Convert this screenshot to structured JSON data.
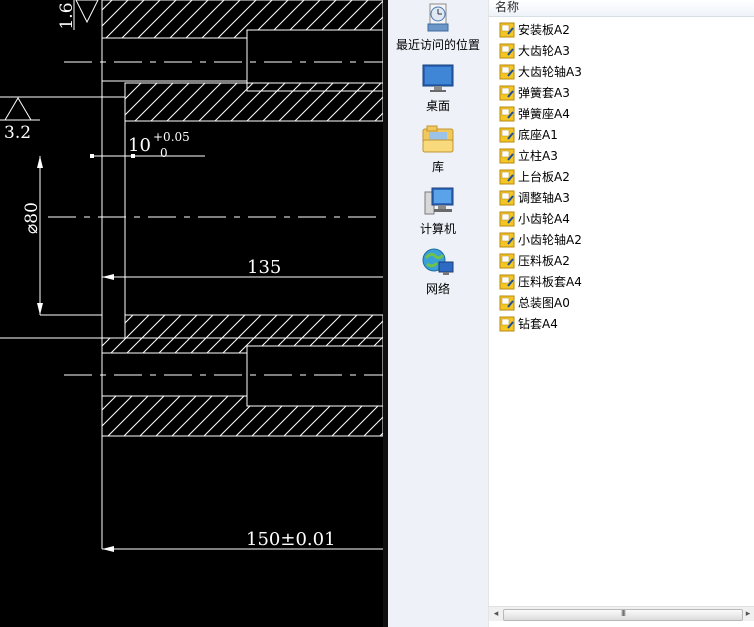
{
  "cad": {
    "dimensions": {
      "roughness_top": "1.6",
      "roughness_left": "3.2",
      "tolerance_base": "10",
      "tolerance_upper": "+0.05",
      "tolerance_lower": "0",
      "diameter": "⌀80",
      "length_inner": "135",
      "length_outer": "150±0.01"
    }
  },
  "places": [
    {
      "label": "最近访问的位置",
      "icon": "recent-places-icon"
    },
    {
      "label": "桌面",
      "icon": "desktop-icon"
    },
    {
      "label": "库",
      "icon": "libraries-icon"
    },
    {
      "label": "计算机",
      "icon": "computer-icon"
    },
    {
      "label": "网络",
      "icon": "network-icon"
    }
  ],
  "file_list": {
    "column_name": "名称",
    "items": [
      "安装板A2",
      "大齿轮A3",
      "大齿轮轴A3",
      "弹簧套A3",
      "弹簧座A4",
      "底座A1",
      "立柱A3",
      "上台板A2",
      "调整轴A3",
      "小齿轮A4",
      "小齿轮轴A2",
      "压料板A2",
      "压料板套A4",
      "总装图A0",
      "钻套A4"
    ],
    "scrollbar_grip": "III"
  },
  "colors": {
    "cad_background": "#000000",
    "cad_lines": "#ffffff",
    "places_background": "#eef2f8",
    "file_icon": "#f3c623"
  }
}
